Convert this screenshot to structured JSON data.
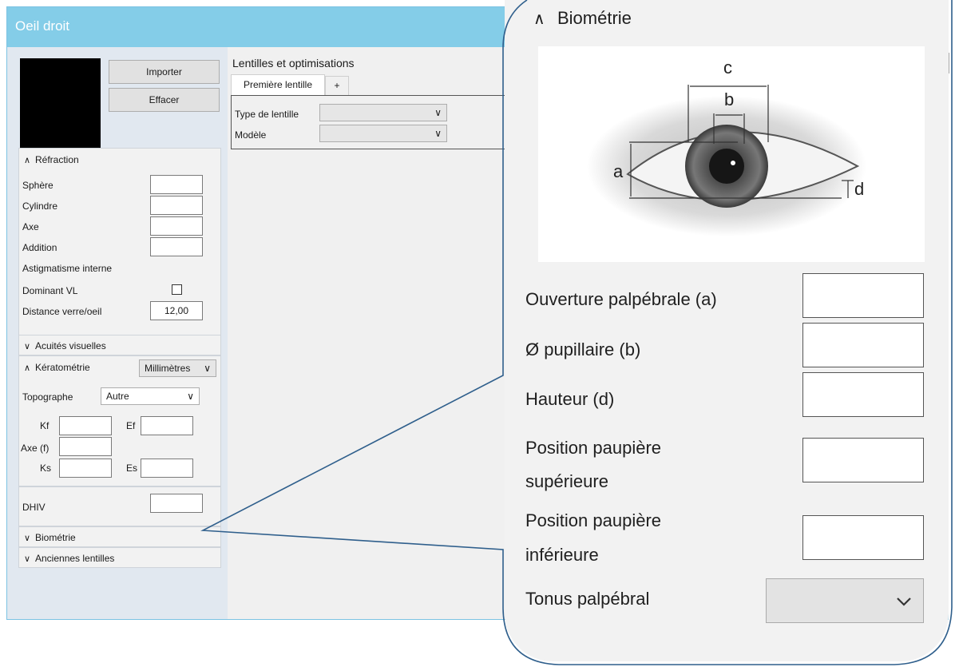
{
  "window": {
    "title": "Oeil droit"
  },
  "photo": {
    "import_label": "Importer",
    "clear_label": "Effacer"
  },
  "refraction": {
    "title": "Réfraction",
    "sphere_label": "Sphère",
    "sphere_value": "",
    "cylinder_label": "Cylindre",
    "cylinder_value": "",
    "axis_label": "Axe",
    "axis_value": "",
    "addition_label": "Addition",
    "addition_value": "",
    "internal_astig_label": "Astigmatisme interne",
    "dominant_label": "Dominant VL",
    "distance_label": "Distance verre/oeil",
    "distance_value": "12,00"
  },
  "acuity": {
    "title": "Acuités visuelles"
  },
  "keratometry": {
    "title": "Kératométrie",
    "unit_value": "Millimètres",
    "topographer_label": "Topographe",
    "topographer_value": "Autre",
    "kf_label": "Kf",
    "ef_label": "Ef",
    "axis_f_label": "Axe (f)",
    "ks_label": "Ks",
    "es_label": "Es"
  },
  "dhiv": {
    "label": "DHIV",
    "value": ""
  },
  "biometry_collapsed": {
    "title": "Biométrie"
  },
  "old_lenses": {
    "title": "Anciennes lentilles"
  },
  "lenses": {
    "title": "Lentilles et optimisations",
    "tab_first": "Première lentille",
    "tab_add": "+",
    "type_label": "Type de lentille",
    "model_label": "Modèle"
  },
  "biometry": {
    "title": "Biométrie",
    "diagram_labels": {
      "a": "a",
      "b": "b",
      "c": "c",
      "d": "d"
    },
    "palpebral_opening_label": "Ouverture palpébrale (a)",
    "pupil_label": "Ø pupillaire (b)",
    "height_label": "Hauteur (d)",
    "upper_lid_label_1": "Position paupière",
    "upper_lid_label_2": "supérieure",
    "lower_lid_label_1": "Position paupière",
    "lower_lid_label_2": "inférieure",
    "tone_label": "Tonus palpébral",
    "tone_value": ""
  }
}
